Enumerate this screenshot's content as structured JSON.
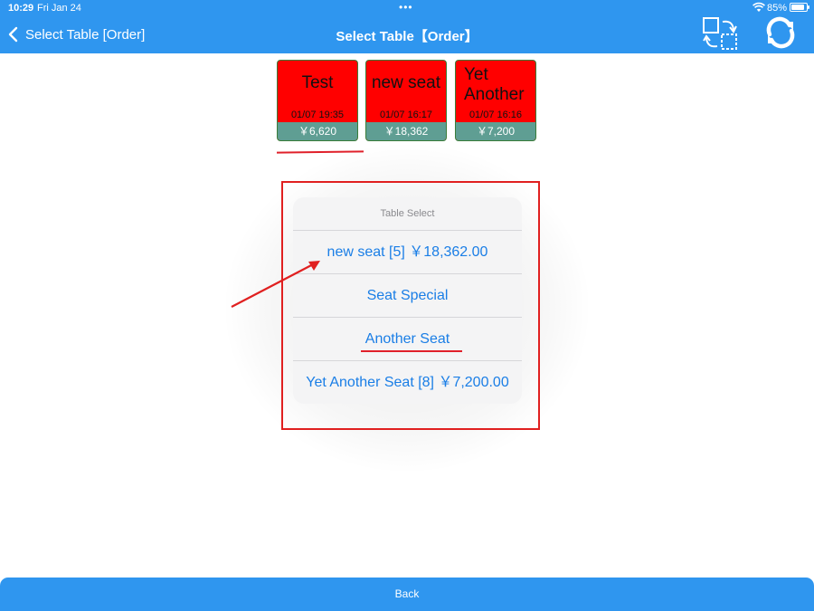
{
  "status_bar": {
    "time": "10:29",
    "date": "Fri Jan 24",
    "battery": "85%",
    "icons": [
      "wifi-icon",
      "battery-icon"
    ]
  },
  "nav": {
    "back_label": "Select Table [Order]",
    "title": "Select Table【Order】",
    "icons": [
      "chevron-left-icon",
      "swap-tables-icon",
      "refresh-icon"
    ]
  },
  "tiles": [
    {
      "name": "Test",
      "time": "01/07 19:35",
      "price": "￥6,620"
    },
    {
      "name": "new seat",
      "time": "01/07 16:17",
      "price": "￥18,362"
    },
    {
      "name": "Yet\nAnother",
      "time": "01/07 16:16",
      "price": "￥7,200"
    }
  ],
  "sheet": {
    "title": "Table Select",
    "options": [
      "new seat [5] ￥18,362.00",
      "Seat Special",
      "Another Seat",
      "Yet Another Seat [8] ￥7,200.00"
    ]
  },
  "bottom": {
    "back_label": "Back"
  },
  "colors": {
    "accent": "#2f96ef",
    "tile_bg": "#ff0000",
    "tile_price_bg": "#5f9e93",
    "link": "#1a7ee6",
    "annotation": "#e02020"
  }
}
